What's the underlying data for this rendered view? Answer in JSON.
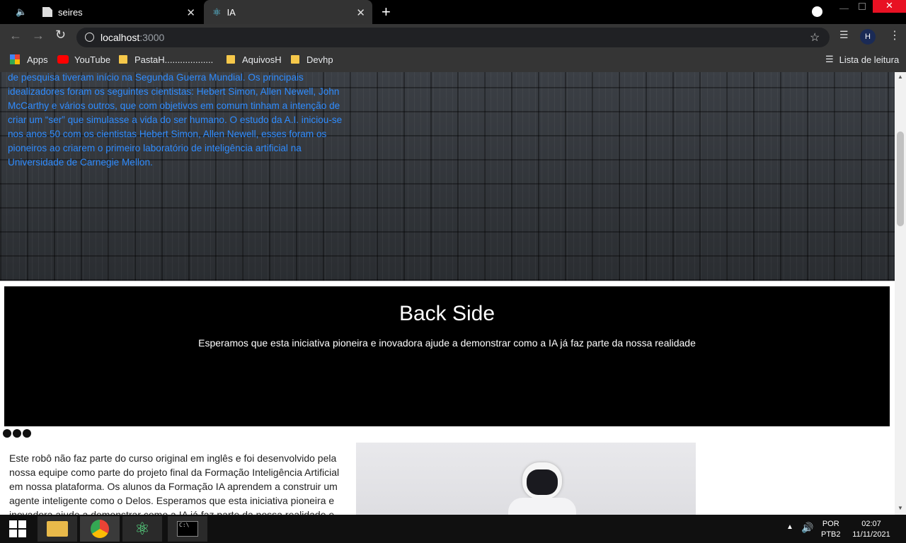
{
  "tabs": [
    {
      "label": "seires",
      "icon": "page-icon"
    },
    {
      "label": "IA",
      "icon": "react-icon"
    }
  ],
  "toolbar": {
    "url_host": "localhost",
    "url_port": ":3000"
  },
  "bookmarks": {
    "apps": "Apps",
    "items": [
      "YouTube",
      "PastaH.............................",
      "AquivosH",
      "Devhp"
    ],
    "reading_list": "Lista de leitura"
  },
  "hero": {
    "paragraph": "de pesquisa tiveram início na Segunda Guerra Mundial. Os principais idealizadores foram os seguintes cientistas: Hebert Simon, Allen Newell, John McCarthy e vários outros, que com objetivos em comum tinham a intenção de criar um “ser” que simulasse a vida do ser humano. O estudo da A.I. iniciou-se nos anos 50 com os cientistas Hebert Simon, Allen Newell, esses foram os pioneiros ao criarem o primeiro laboratório de inteligência artificial na Universidade de Carnegie Mellon.",
    "text_color": "#2f8cff"
  },
  "panel": {
    "title": "Back Side",
    "subtitle": "Esperamos que esta iniciativa pioneira e inovadora ajude a demonstrar como a IA já faz parte da nossa realidade"
  },
  "section": {
    "paragraph": "Este robô não faz parte do curso original em inglês e foi desenvolvido pela nossa equipe como parte do projeto final da Formação Inteligência Artificial em nossa plataforma. Os alunos da Formação IA aprendem a construir um agente inteligente como o Delos. Esperamos que esta iniciativa pioneira e inovadora ajude a demonstrar como a IA já faz parte da nossa realidade e os"
  },
  "taskbar": {
    "lang_top": "POR",
    "lang_bottom": "PTB2",
    "time": "02:07",
    "date": "11/11/2021"
  }
}
